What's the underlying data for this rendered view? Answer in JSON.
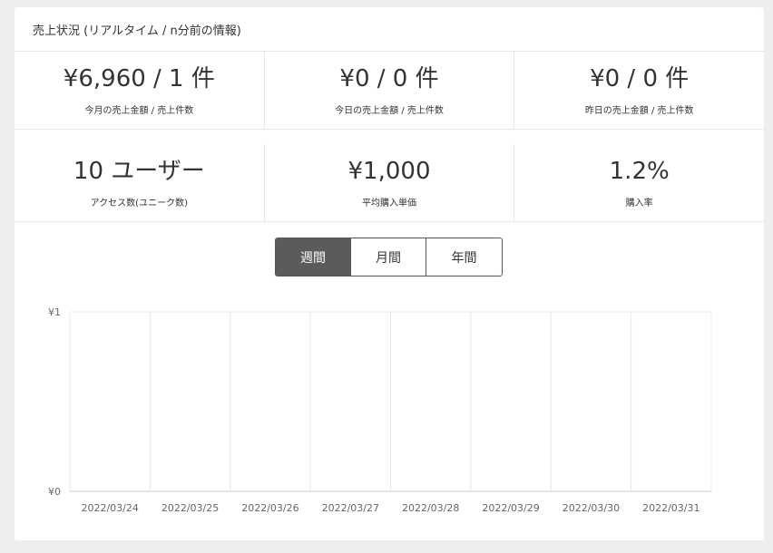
{
  "header": {
    "title": "売上状況 (リアルタイム / n分前の情報)"
  },
  "stats": {
    "month": {
      "value": "¥6,960 / 1 件",
      "label": "今月の売上金額 / 売上件数"
    },
    "today": {
      "value": "¥0 / 0 件",
      "label": "今日の売上金額 / 売上件数"
    },
    "yesterday": {
      "value": "¥0 / 0 件",
      "label": "昨日の売上金額 / 売上件数"
    },
    "access": {
      "value": "10 ユーザー",
      "label": "アクセス数(ユニーク数)"
    },
    "avg_price": {
      "value": "¥1,000",
      "label": "平均購入単価"
    },
    "purchase_rate": {
      "value": "1.2%",
      "label": "購入率"
    }
  },
  "period_tabs": [
    {
      "label": "週間",
      "active": true
    },
    {
      "label": "月間",
      "active": false
    },
    {
      "label": "年間",
      "active": false
    }
  ],
  "colors": {
    "active_tab": "#5b5b5b",
    "grid": "#e8e8e8",
    "axis": "#cccccc"
  },
  "chart_data": {
    "type": "line",
    "x": [
      "2022/03/24",
      "2022/03/25",
      "2022/03/26",
      "2022/03/27",
      "2022/03/28",
      "2022/03/29",
      "2022/03/30",
      "2022/03/31"
    ],
    "series": [
      {
        "values": [
          0,
          0,
          0,
          0,
          0,
          0,
          0,
          0
        ]
      }
    ],
    "ylim": [
      0,
      1
    ],
    "yticks": [
      "¥0",
      "¥1"
    ],
    "grid": true
  }
}
